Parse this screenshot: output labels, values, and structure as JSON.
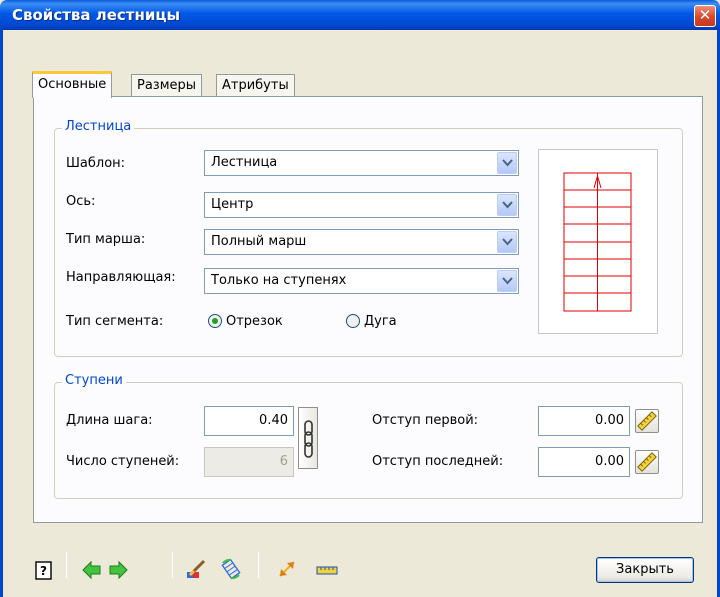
{
  "window": {
    "title": "Свойства лестницы",
    "close_glyph": "✕"
  },
  "tabs": [
    {
      "label": "Основные",
      "active": true
    },
    {
      "label": "Размеры",
      "active": false
    },
    {
      "label": "Атрибуты",
      "active": false
    }
  ],
  "stair_group": {
    "title": "Лестница",
    "template": {
      "label": "Шаблон:",
      "value": "Лестница"
    },
    "axis": {
      "label": "Ось:",
      "value": "Центр"
    },
    "march_type": {
      "label": "Тип марша:",
      "value": "Полный марш"
    },
    "guide": {
      "label": "Направляющая:",
      "value": "Только на ступенях"
    },
    "segment_type": {
      "label": "Тип сегмента:",
      "options": [
        {
          "label": "Отрезок",
          "selected": true
        },
        {
          "label": "Дуга",
          "selected": false
        }
      ]
    }
  },
  "steps_group": {
    "title": "Ступени",
    "step_length": {
      "label": "Длина шага:",
      "value": "0.40"
    },
    "step_count": {
      "label": "Число ступеней:",
      "value": "6"
    },
    "first_offset": {
      "label": "Отступ первой:",
      "value": "0.00"
    },
    "last_offset": {
      "label": "Отступ последней:",
      "value": "0.00"
    }
  },
  "toolbar": {
    "icons": [
      "help-icon",
      "arrow-left-icon",
      "arrow-right-icon",
      "paint-brush-icon",
      "rotate-icon",
      "resize-icon",
      "ruler-icon"
    ],
    "close_label": "Закрыть"
  },
  "colors": {
    "titlebar": "#0058e6",
    "group_title": "#0046d5",
    "preview_lines": "#e00000",
    "arrow_green": "#3fbf3f"
  }
}
